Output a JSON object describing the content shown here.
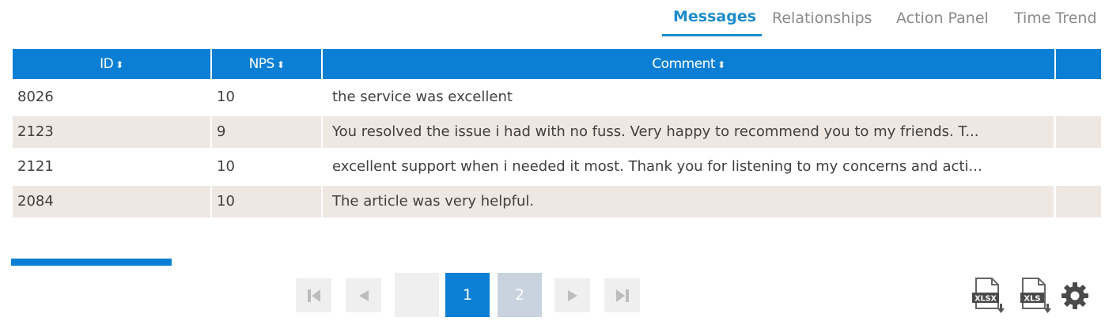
{
  "tabs": [
    {
      "label": "Messages",
      "active": true
    },
    {
      "label": "Relationships",
      "active": false
    },
    {
      "label": "Action Panel",
      "active": false
    },
    {
      "label": "Time Trend",
      "active": false
    }
  ],
  "table": {
    "columns": [
      "ID",
      "NPS",
      "Comment"
    ],
    "sort_icon": "sort-icon",
    "rows": [
      {
        "id": "8026",
        "nps": "10",
        "comment": "the service was excellent"
      },
      {
        "id": "2123",
        "nps": "9",
        "comment": "You resolved the issue i had with no fuss. Very happy to recommend you to my friends. T..."
      },
      {
        "id": "2121",
        "nps": "10",
        "comment": "excellent support when i needed it most. Thank you for listening to my concerns and acti..."
      },
      {
        "id": "2084",
        "nps": "10",
        "comment": "The article was very helpful."
      }
    ]
  },
  "pagination": {
    "pages": [
      "1",
      "2"
    ],
    "current": "1",
    "icons": [
      "first-page-icon",
      "prev-page-icon",
      "next-page-icon",
      "last-page-icon"
    ]
  },
  "export": {
    "xlsx_label": "XLSX",
    "xls_label": "XLS",
    "settings_icon": "gear-icon"
  },
  "colors": {
    "accent": "#0a7fd4",
    "tab_active": "#1a8ccc",
    "row_alt": "#efe7e2"
  }
}
